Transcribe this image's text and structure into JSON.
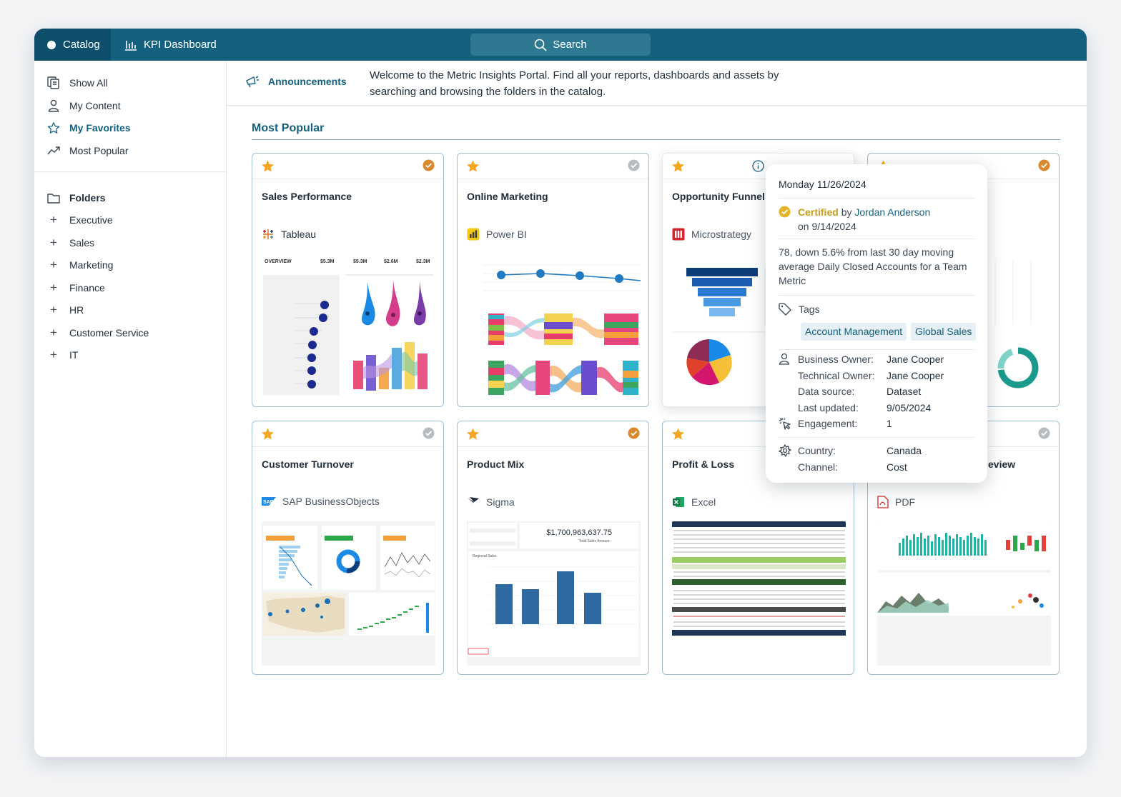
{
  "topbar": {
    "catalog_label": "Catalog",
    "kpi_label": "KPI Dashboard",
    "search_label": "Search"
  },
  "sidebar": {
    "items": [
      {
        "label": "Show All",
        "icon": "documents-icon"
      },
      {
        "label": "My Content",
        "icon": "user-icon"
      },
      {
        "label": "My Favorites",
        "icon": "star-icon"
      },
      {
        "label": "Most Popular",
        "icon": "trend-icon"
      }
    ],
    "folders_label": "Folders",
    "folders": [
      "Executive",
      "Sales",
      "Marketing",
      "Finance",
      "HR",
      "Customer Service",
      "IT"
    ]
  },
  "announcement": {
    "label": "Announcements",
    "text": "Welcome to the Metric Insights Portal. Find all your reports, dashboards and assets by searching and browsing the folders in the catalog."
  },
  "section_title": "Most Popular",
  "cards": [
    {
      "title": "Sales Performance",
      "source": "Tableau",
      "certified": true
    },
    {
      "title": "Online Marketing",
      "source": "Power BI",
      "certified": false
    },
    {
      "title": "Opportunity Funnel",
      "source": "Microstrategy",
      "certified": true
    },
    {
      "title": "",
      "source": "",
      "certified": true
    },
    {
      "title": "Customer Turnover",
      "source": "SAP BusinessObjects",
      "certified": false
    },
    {
      "title": "Product Mix",
      "source": "Sigma",
      "certified": true
    },
    {
      "title": "Profit & Loss",
      "source": "Excel",
      "certified": false
    },
    {
      "title": "eview",
      "source": "PDF",
      "certified": false
    }
  ],
  "thumbs": {
    "tableau_overview": "OVERVIEW",
    "tableau_kpis": [
      "$5.3M",
      "$5.3M",
      "$2.6M",
      "$2.3M"
    ],
    "sigma_total": "$1,700,963,637.75",
    "sigma_total_label": "Total Sales Amount",
    "sigma_regional": "Regional Sales"
  },
  "tooltip": {
    "date": "Monday 11/26/2024",
    "certified_word": "Certified",
    "by_word": "by",
    "certified_by": "Jordan Anderson",
    "certified_on": "on 9/14/2024",
    "description": "78, down 5.6% from last 30 day moving average Daily Closed Accounts for a Team Metric",
    "tags_label": "Tags",
    "tags": [
      "Account Management",
      "Global Sales"
    ],
    "details": [
      {
        "label": "Business Owner:",
        "value": "Jane Cooper"
      },
      {
        "label": "Technical Owner:",
        "value": "Jane Cooper"
      },
      {
        "label": "Data source:",
        "value": "Dataset"
      },
      {
        "label": "Last updated:",
        "value": "9/05/2024"
      },
      {
        "label": "Engagement:",
        "value": "1"
      }
    ],
    "dimensions": [
      {
        "label": "Country:",
        "value": "Canada"
      },
      {
        "label": "Channel:",
        "value": "Cost"
      }
    ]
  },
  "colors": {
    "brand": "#13607f",
    "star": "#f5a623",
    "certified": "#d9892b",
    "uncertified": "#b6bcc2"
  }
}
